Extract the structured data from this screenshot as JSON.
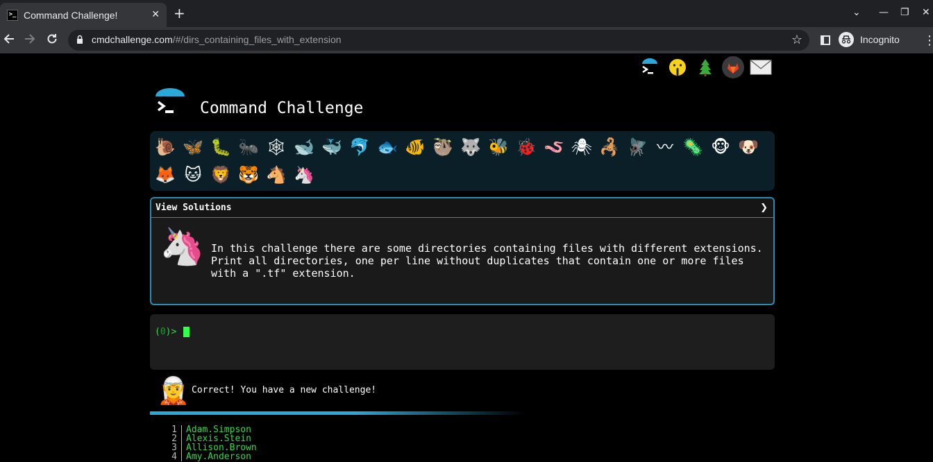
{
  "browser": {
    "tab_title": "Command Challenge!",
    "tab_close": "✕",
    "new_tab": "+",
    "url_host": "cmdchallenge.com",
    "url_path": "/#/dirs_containing_files_with_extension",
    "profile_label": "Incognito",
    "window_controls": {
      "dropdown": "⌄",
      "minimize": "—",
      "maximize": "❐",
      "close": "✕"
    }
  },
  "top_links": [
    {
      "name": "cmdchallenge-icon",
      "glyph": ""
    },
    {
      "name": "shush-face-icon",
      "glyph": "🤫"
    },
    {
      "name": "tree-icon",
      "glyph": "🌲"
    },
    {
      "name": "gitlab-icon",
      "glyph": ""
    },
    {
      "name": "mail-icon",
      "glyph": "✉"
    }
  ],
  "header": {
    "title": "Command Challenge"
  },
  "levels": [
    {
      "icon": "snail-icon",
      "glyph": "🐌"
    },
    {
      "icon": "butterfly-icon",
      "glyph": "🦋"
    },
    {
      "icon": "caterpillar-icon",
      "glyph": "🐛"
    },
    {
      "icon": "ant-icon",
      "glyph": "🐜"
    },
    {
      "icon": "spider-web-icon",
      "glyph": "🕸"
    },
    {
      "icon": "whale-icon",
      "glyph": "🐋"
    },
    {
      "icon": "spouting-whale-icon",
      "glyph": "🐳"
    },
    {
      "icon": "dolphin-icon",
      "glyph": "🐬"
    },
    {
      "icon": "fish-icon",
      "glyph": "🐟"
    },
    {
      "icon": "tropical-fish-icon",
      "glyph": "🐠"
    },
    {
      "icon": "sloth-icon",
      "glyph": "🦥"
    },
    {
      "icon": "wolf-icon",
      "glyph": "🐺"
    },
    {
      "icon": "bee-icon",
      "glyph": "🐝"
    },
    {
      "icon": "ladybug-icon",
      "glyph": "🐞"
    },
    {
      "icon": "worm-icon",
      "glyph": "🪱"
    },
    {
      "icon": "spider-icon",
      "glyph": "🕷"
    },
    {
      "icon": "scorpion-icon",
      "glyph": "🦂"
    },
    {
      "icon": "fly-icon",
      "glyph": "🪰"
    },
    {
      "icon": "earthworm-icon",
      "glyph": "〰"
    },
    {
      "icon": "microbe-icon",
      "glyph": "🦠"
    },
    {
      "icon": "monkey-icon",
      "glyph": "🐵"
    },
    {
      "icon": "dog-icon",
      "glyph": "🐶"
    },
    {
      "icon": "fox-icon",
      "glyph": "🦊"
    },
    {
      "icon": "cat-icon",
      "glyph": "🐱"
    },
    {
      "icon": "lion-icon",
      "glyph": "🦁"
    },
    {
      "icon": "tiger-icon",
      "glyph": "🐯"
    },
    {
      "icon": "horse-icon",
      "glyph": "🐴"
    },
    {
      "icon": "unicorn-icon",
      "glyph": "🦄"
    }
  ],
  "solutions": {
    "label": "View Solutions",
    "chevron": "❯",
    "challenge_icon": "🦄",
    "description": "In this challenge there are some directories containing files with different extensions. Print all directories, one per line without duplicates that contain one or more files with a \".tf\" extension."
  },
  "terminal": {
    "prompt_open": "(",
    "exit_code": "0",
    "prompt_close": ")>"
  },
  "status": {
    "avatar": "🧝",
    "message": "Correct! You have a new challenge!"
  },
  "leaderboard": [
    {
      "rank": "1",
      "name": "Adam.Simpson"
    },
    {
      "rank": "2",
      "name": "Alexis.Stein"
    },
    {
      "rank": "3",
      "name": "Allison.Brown"
    },
    {
      "rank": "4",
      "name": "Amy.Anderson"
    }
  ],
  "colors": {
    "accent": "#2aa9d8",
    "terminal_green": "#32d94a",
    "panel_bg": "#1a1a1a"
  }
}
